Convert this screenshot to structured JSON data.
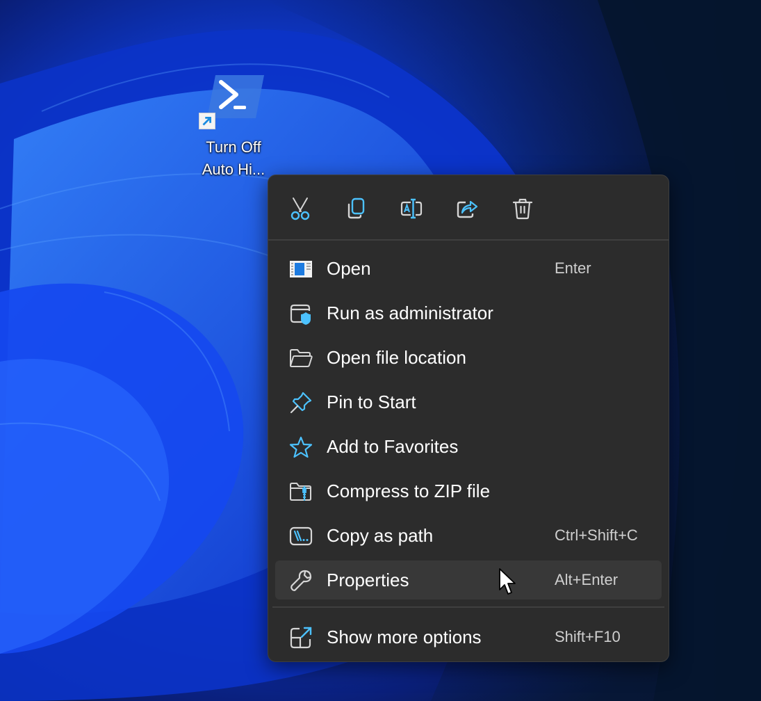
{
  "desktop": {
    "icon": {
      "name": "powershell-shortcut",
      "label_line1": "Turn Off",
      "label_line2": "Auto Hi..."
    }
  },
  "context_menu": {
    "toolbar": [
      {
        "id": "cut",
        "label": "Cut",
        "icon": "scissors-icon"
      },
      {
        "id": "copy",
        "label": "Copy",
        "icon": "copy-icon"
      },
      {
        "id": "rename",
        "label": "Rename",
        "icon": "rename-icon"
      },
      {
        "id": "share",
        "label": "Share",
        "icon": "share-icon"
      },
      {
        "id": "delete",
        "label": "Delete",
        "icon": "trash-icon"
      }
    ],
    "items": [
      {
        "label": "Open",
        "shortcut": "Enter",
        "icon": "open-window-icon"
      },
      {
        "label": "Run as administrator",
        "shortcut": "",
        "icon": "shield-window-icon"
      },
      {
        "label": "Open file location",
        "shortcut": "",
        "icon": "folder-icon"
      },
      {
        "label": "Pin to Start",
        "shortcut": "",
        "icon": "pin-icon"
      },
      {
        "label": "Add to Favorites",
        "shortcut": "",
        "icon": "star-icon"
      },
      {
        "label": "Compress to ZIP file",
        "shortcut": "",
        "icon": "zip-folder-icon"
      },
      {
        "label": "Copy as path",
        "shortcut": "Ctrl+Shift+C",
        "icon": "path-icon"
      },
      {
        "label": "Properties",
        "shortcut": "Alt+Enter",
        "icon": "wrench-icon",
        "hovered": true
      },
      {
        "label": "Show more options",
        "shortcut": "Shift+F10",
        "icon": "expand-icon"
      }
    ]
  },
  "colors": {
    "accent": "#4cc2ff",
    "menu_bg": "#2c2c2c",
    "hover_bg": "#383838",
    "text": "#ffffff",
    "shortcut_text": "#cfcfcf"
  }
}
